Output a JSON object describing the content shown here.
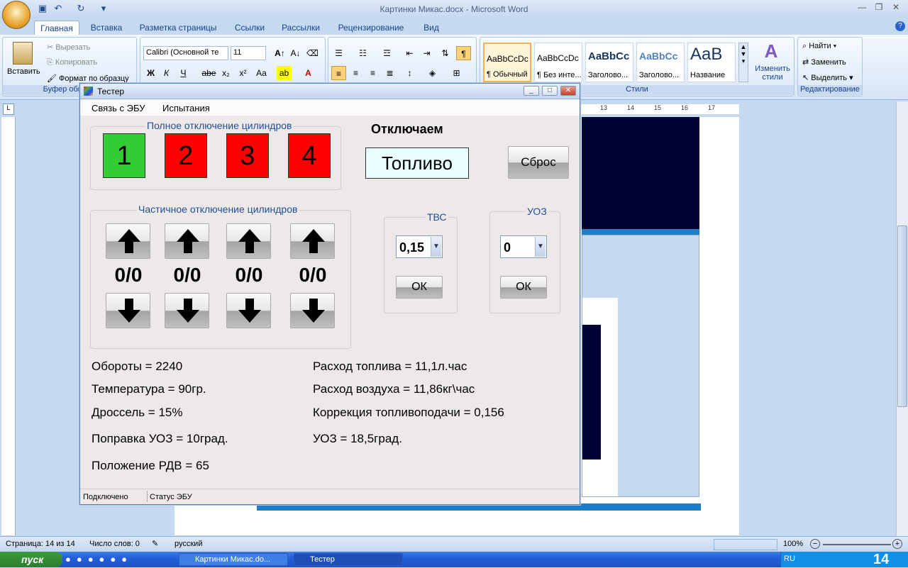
{
  "word": {
    "title": "Картинки Микас.docx - Microsoft Word",
    "tabs": [
      "Главная",
      "Вставка",
      "Разметка страницы",
      "Ссылки",
      "Рассылки",
      "Рецензирование",
      "Вид"
    ],
    "clipboard": {
      "paste": "Вставить",
      "cut": "Вырезать",
      "copy": "Копировать",
      "format_painter": "Формат по образцу",
      "group": "Буфер обмена"
    },
    "font": {
      "name": "Calibri (Основной те",
      "size": "11"
    },
    "styles": [
      {
        "preview": "AaBbCcDc",
        "name": "¶ Обычный"
      },
      {
        "preview": "AaBbCcDc",
        "name": "¶ Без инте..."
      },
      {
        "preview": "AaBbCc",
        "name": "Заголово..."
      },
      {
        "preview": "AaBbCc",
        "name": "Заголово..."
      },
      {
        "preview": "AaB",
        "name": "Название"
      }
    ],
    "change_styles": "Изменить стили",
    "styles_group": "Стили",
    "editing": {
      "find": "Найти",
      "replace": "Заменить",
      "select": "Выделить",
      "group": "Редактирование"
    },
    "ruler_marks": [
      "13",
      "14",
      "15",
      "16",
      "17"
    ],
    "status": {
      "page": "Страница: 14 из 14",
      "words": "Число слов: 0",
      "lang": "русский",
      "zoom": "100%"
    }
  },
  "taskbar": {
    "start": "пуск",
    "items": [
      "Картинки Микас.do...",
      "Тестер"
    ],
    "lang": "RU",
    "clock": "14"
  },
  "tester": {
    "title": "Тестер",
    "menu": [
      "Связь с ЭБУ",
      "Испытания"
    ],
    "full_cutoff": {
      "title": "Полное отключение цилиндров",
      "cylinders": [
        {
          "label": "1",
          "color": "#33cc33"
        },
        {
          "label": "2",
          "color": "#ff0000"
        },
        {
          "label": "3",
          "color": "#ff0000"
        },
        {
          "label": "4",
          "color": "#ff0000"
        }
      ]
    },
    "disable_heading": "Отключаем",
    "disable_value": "Топливо",
    "reset_label": "Сброс",
    "partial_cutoff": {
      "title": "Частичное отключение цилиндров",
      "counts": [
        "0/0",
        "0/0",
        "0/0",
        "0/0"
      ]
    },
    "tvs": {
      "title": "ТВС",
      "value": "0,15",
      "ok": "ОК"
    },
    "uoz": {
      "title": "УОЗ",
      "value": "0",
      "ok": "ОК"
    },
    "left_info": [
      "Обороты = 2240",
      "Температура = 90гр.",
      "Дроссель = 15%",
      "Поправка УОЗ = 10град.",
      "Положение РДВ = 65"
    ],
    "right_info": [
      "Расход топлива = 11,1л.час",
      "Расход воздуха = 11,86кг\\час",
      "Коррекция топливоподачи = 0,156",
      "УОЗ = 18,5град."
    ],
    "status": [
      "Подключено",
      "Статус ЭБУ"
    ]
  }
}
